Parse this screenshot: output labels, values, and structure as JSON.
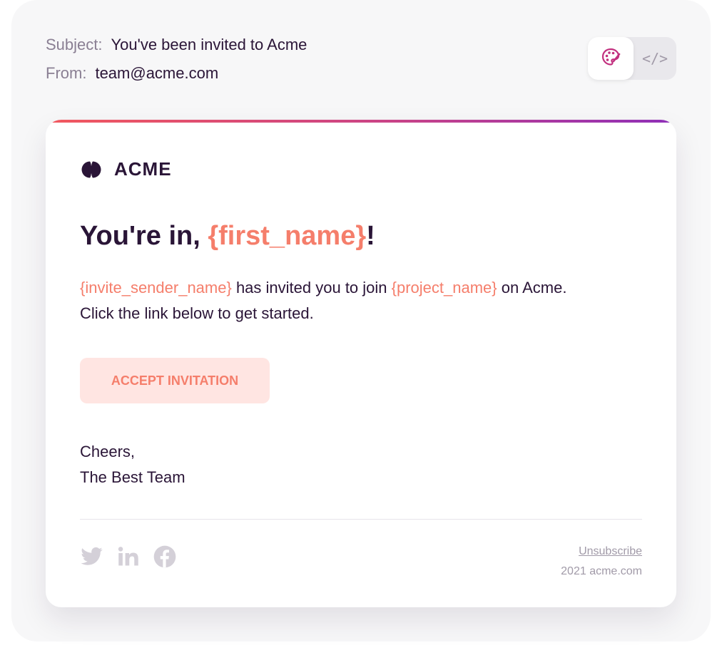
{
  "header": {
    "subject_label": "Subject:",
    "subject_value": "You've been invited to Acme",
    "from_label": "From:",
    "from_value": "team@acme.com"
  },
  "toggle": {
    "design_icon": "palette-icon",
    "code_label": "</>"
  },
  "colors": {
    "accent": "#f57e6b",
    "text": "#2a1537",
    "muted": "#a19aa8",
    "button_bg": "#ffe5e2",
    "gradient": [
      "#f2585e",
      "#c94387",
      "#8e2fb8"
    ]
  },
  "email": {
    "logo_text": "ACME",
    "headline_prefix": "You're in, ",
    "headline_var": "{first_name}",
    "headline_suffix": "!",
    "body_var_sender": "{invite_sender_name}",
    "body_text_1": " has invited you to join ",
    "body_var_project": "{project_name}",
    "body_text_2": " on Acme.",
    "body_line_2": "Click the link below to get started.",
    "button_label": "ACCEPT INVITATION",
    "signoff_line_1": "Cheers,",
    "signoff_line_2": "The Best Team"
  },
  "footer": {
    "social_icons": [
      "twitter-icon",
      "linkedin-icon",
      "facebook-icon"
    ],
    "unsubscribe": "Unsubscribe",
    "copyright": "2021 acme.com"
  }
}
